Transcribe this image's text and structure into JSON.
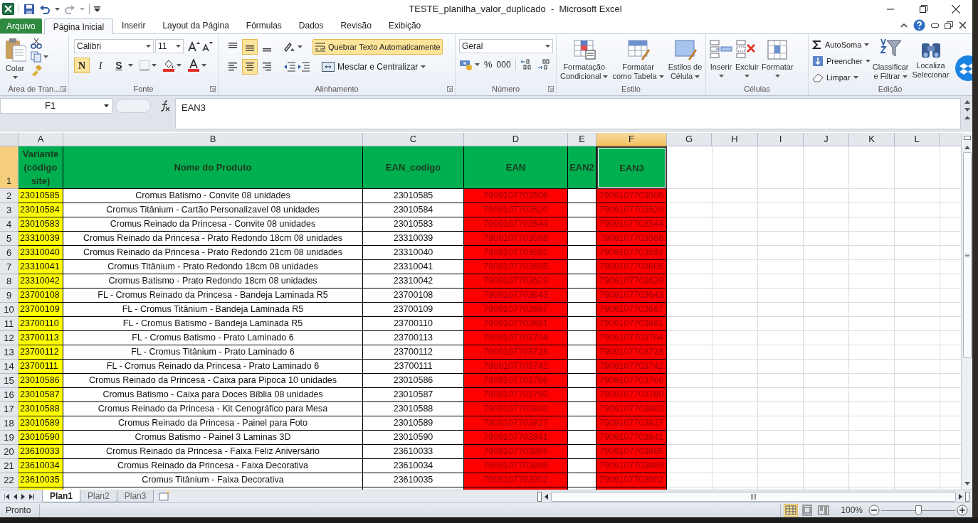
{
  "window": {
    "title": "TESTE_planilha_valor_duplicado  -  Microsoft Excel"
  },
  "tabs": [
    {
      "label": "Arquivo",
      "kind": "file",
      "selected": false
    },
    {
      "label": "Página Inicial",
      "kind": "tab",
      "selected": true
    },
    {
      "label": "Inserir",
      "kind": "tab",
      "selected": false
    },
    {
      "label": "Layout da Página",
      "kind": "tab",
      "selected": false
    },
    {
      "label": "Fórmulas",
      "kind": "tab",
      "selected": false
    },
    {
      "label": "Dados",
      "kind": "tab",
      "selected": false
    },
    {
      "label": "Revisão",
      "kind": "tab",
      "selected": false
    },
    {
      "label": "Exibição",
      "kind": "tab",
      "selected": false
    }
  ],
  "ribbon": {
    "clipboard": {
      "label": "Área de Tran...",
      "paste": "Colar"
    },
    "font": {
      "label": "Fonte",
      "font_name": "Calibri",
      "font_size": "11",
      "bold": {
        "label": "N",
        "selected": true
      },
      "italic": {
        "label": "I",
        "selected": false
      },
      "underline": {
        "label": "S",
        "selected": false
      }
    },
    "alignment": {
      "label": "Alinhamento",
      "vertical": [
        {
          "selected": false
        },
        {
          "selected": true
        },
        {
          "selected": false
        }
      ],
      "horizontal": [
        {
          "selected": false
        },
        {
          "selected": true
        },
        {
          "selected": false
        }
      ],
      "wrap_text": {
        "label": "Quebrar Texto Automaticamente",
        "selected": true
      },
      "merge": "Mesclar e Centralizar"
    },
    "number": {
      "label": "Número",
      "format": "Geral",
      "percent": "%",
      "thousands": "000"
    },
    "styles": {
      "label": "Estilo",
      "buttons": [
        [
          "Formatação",
          "Condicional"
        ],
        [
          "Formatar",
          "como Tabela"
        ],
        [
          "Estilos de",
          "Célula"
        ]
      ]
    },
    "cells": {
      "label": "Células",
      "buttons": [
        "Inserir",
        "Excluir",
        "Formatar"
      ]
    },
    "editing": {
      "label": "Edição",
      "small": [
        "AutoSoma",
        "Preencher",
        "Limpar"
      ],
      "large": [
        [
          "Classificar",
          "e Filtrar"
        ],
        [
          "Localiza",
          "Selecionar"
        ]
      ]
    }
  },
  "formula_bar": {
    "name_box": "F1",
    "value": "EAN3"
  },
  "table": {
    "columns": [
      {
        "letter": "A",
        "selected": false,
        "color": "#ffff00"
      },
      {
        "letter": "B",
        "selected": false,
        "color": "#ffffff"
      },
      {
        "letter": "C",
        "selected": false,
        "color": "#ffffff"
      },
      {
        "letter": "D",
        "selected": false,
        "color": "#ff0000"
      },
      {
        "letter": "E",
        "selected": false,
        "color": "#ffffff"
      },
      {
        "letter": "F",
        "selected": true,
        "color": "#ff0000"
      },
      {
        "letter": "G",
        "selected": false
      },
      {
        "letter": "H",
        "selected": false
      },
      {
        "letter": "I",
        "selected": false
      },
      {
        "letter": "J",
        "selected": false
      },
      {
        "letter": "K",
        "selected": false
      },
      {
        "letter": "L",
        "selected": false
      }
    ],
    "header_row": {
      "number": "1",
      "selected": true,
      "cells": [
        "Variante (código site)",
        "Nome do Produto",
        "EAN_codigo",
        "EAN",
        "EAN2",
        "EAN3"
      ]
    },
    "rows": [
      {
        "number": "2",
        "variant": "23010585",
        "product": "Cromus Batismo - Convite 08 unidades",
        "ean_code": "23010585",
        "ean": "7909107703506",
        "ean3": "7909107703506"
      },
      {
        "number": "3",
        "variant": "23010584",
        "product": "Cromus Titânium - Cartão Personalizavel 08 unidades",
        "ean_code": "23010584",
        "ean": "7909107703520",
        "ean3": "7909107703520"
      },
      {
        "number": "4",
        "variant": "23010583",
        "product": "Cromus Reinado da Princesa - Convite 08 unidades",
        "ean_code": "23010583",
        "ean": "7909107703544",
        "ean3": "7909107703544"
      },
      {
        "number": "5",
        "variant": "23310039",
        "product": "Cromus Reinado da Princesa - Prato Redondo 18cm 08 unidades",
        "ean_code": "23310039",
        "ean": "7909107703568",
        "ean3": "7909107703568"
      },
      {
        "number": "6",
        "variant": "23310040",
        "product": "Cromus Reinado da Princesa - Prato Redondo 21cm 08 unidades",
        "ean_code": "23310040",
        "ean": "7909107703582",
        "ean3": "7909107703582"
      },
      {
        "number": "7",
        "variant": "23310041",
        "product": "Cromus Titânium - Prato Redondo 18cm 08 unidades",
        "ean_code": "23310041",
        "ean": "7909107703605",
        "ean3": "7909107703605"
      },
      {
        "number": "8",
        "variant": "23310042",
        "product": "Cromus Batismo - Prato Redondo 18cm 08 unidades",
        "ean_code": "23310042",
        "ean": "7909107703629",
        "ean3": "7909107703629"
      },
      {
        "number": "9",
        "variant": "23700108",
        "product": "FL - Cromus Reinado da Princesa - Bandeja Laminada R5",
        "ean_code": "23700108",
        "ean": "7909107703643",
        "ean3": "7909107703643"
      },
      {
        "number": "10",
        "variant": "23700109",
        "product": "FL - Cromus Titânium - Bandeja Laminada R5",
        "ean_code": "23700109",
        "ean": "7909107703667",
        "ean3": "7909107703667"
      },
      {
        "number": "11",
        "variant": "23700110",
        "product": "FL - Cromus Batismo - Bandeja Laminada R5",
        "ean_code": "23700110",
        "ean": "7909107703681",
        "ean3": "7909107703681"
      },
      {
        "number": "12",
        "variant": "23700113",
        "product": "FL - Cromus Batismo - Prato Laminado 6",
        "ean_code": "23700113",
        "ean": "7909107703704",
        "ean3": "7909107703704"
      },
      {
        "number": "13",
        "variant": "23700112",
        "product": "FL - Cromus Titânium - Prato Laminado 6",
        "ean_code": "23700112",
        "ean": "7909107703728",
        "ean3": "7909107703728"
      },
      {
        "number": "14",
        "variant": "23700111",
        "product": "FL - Cromus Reinado da Princesa - Prato Laminado 6",
        "ean_code": "23700111",
        "ean": "7909107703742",
        "ean3": "7909107703742"
      },
      {
        "number": "15",
        "variant": "23010586",
        "product": "Cromus Reinado da Princesa - Caixa para Pipoca 10 unidades",
        "ean_code": "23010586",
        "ean": "7909107703766",
        "ean3": "7909107703766"
      },
      {
        "number": "16",
        "variant": "23010587",
        "product": "Cromus Batismo - Caixa para Doces Bíblia 08 unidades",
        "ean_code": "23010587",
        "ean": "7909107703780",
        "ean3": "7909107703780"
      },
      {
        "number": "17",
        "variant": "23010588",
        "product": "Cromus Reinado da Princesa - Kit Cenográfico para Mesa",
        "ean_code": "23010588",
        "ean": "7909107703803",
        "ean3": "7909107703803"
      },
      {
        "number": "18",
        "variant": "23010589",
        "product": "Cromus Reinado da Princesa - Painel para Foto",
        "ean_code": "23010589",
        "ean": "7909107703827",
        "ean3": "7909107703827"
      },
      {
        "number": "19",
        "variant": "23010590",
        "product": "Cromus Batismo - Painel 3 Laminas 3D",
        "ean_code": "23010590",
        "ean": "7909107703841",
        "ean3": "7909107703841"
      },
      {
        "number": "20",
        "variant": "23610033",
        "product": "Cromus Reinado da Princesa - Faixa Feliz Aniversário",
        "ean_code": "23610033",
        "ean": "7909107703865",
        "ean3": "7909107703865"
      },
      {
        "number": "21",
        "variant": "23610034",
        "product": "Cromus Reinado da Princesa - Faixa Decorativa",
        "ean_code": "23610034",
        "ean": "7909107703889",
        "ean3": "7909107703889"
      },
      {
        "number": "22",
        "variant": "23610035",
        "product": "Cromus Titânium - Faixa Decorativa",
        "ean_code": "23610035",
        "ean": "7909107703902",
        "ean3": "7909107703902"
      }
    ]
  },
  "sheet_tabs": [
    {
      "label": "Plan1",
      "selected": true
    },
    {
      "label": "Plan2",
      "selected": false
    },
    {
      "label": "Plan3",
      "selected": false
    }
  ],
  "status_bar": {
    "status": "Pronto",
    "views": [
      {
        "selected": true
      },
      {
        "selected": false
      },
      {
        "selected": false
      }
    ],
    "zoom": "100%",
    "zoom_slider": {
      "level": 0.5
    }
  }
}
